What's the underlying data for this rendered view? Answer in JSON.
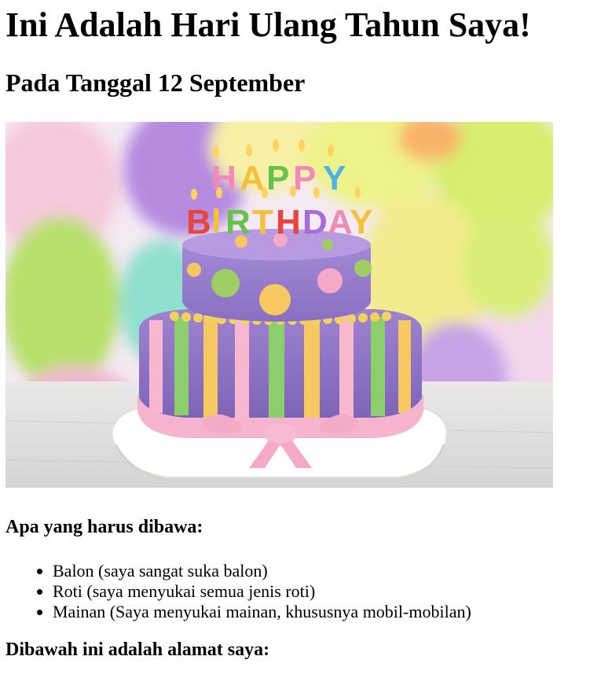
{
  "page": {
    "title": "Ini Adalah Hari Ulang Tahun Saya!",
    "date": "Pada Tanggal 12 September"
  },
  "image": {
    "subject": "cake-photo",
    "topper_line1": "HAPPY",
    "topper_line2": "BIRTHDAY"
  },
  "bring": {
    "heading": "Apa yang harus dibawa:",
    "items": [
      "Balon (saya sangat suka balon)",
      "Roti (saya menyukai semua jenis roti)",
      "Mainan (Saya menyukai mainan, khususnya mobil-mobilan)"
    ]
  },
  "address": {
    "heading": "Dibawah ini adalah alamat saya:"
  },
  "colors": {
    "text": "#000000",
    "background": "#ffffff"
  }
}
